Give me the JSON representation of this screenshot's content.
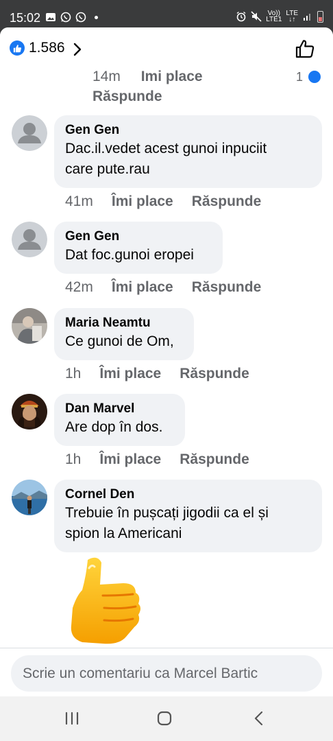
{
  "status_bar": {
    "time": "15:02",
    "volte_top": "Vo))",
    "volte_bottom": "LTE1",
    "network": "LTE"
  },
  "header": {
    "like_count": "1.586",
    "icons": [
      "like-badge-icon",
      "chevron-right-icon",
      "thumbs-up-outline-icon"
    ]
  },
  "partial_comment": {
    "time": "14m",
    "like_label": "Îmi place",
    "reply_label": "Răspunde",
    "reaction_count": "1"
  },
  "comments": [
    {
      "author": "Gen Gen",
      "text_lines": [
        "Dac.il.vedet acest gunoi inpuciit",
        "care pute.rau"
      ],
      "time": "41m",
      "like_label": "Îmi place",
      "reply_label": "Răspunde",
      "avatar": "default-avatar"
    },
    {
      "author": "Gen Gen",
      "text_lines": [
        "Dat foc.gunoi eropei"
      ],
      "time": "42m",
      "like_label": "Îmi place",
      "reply_label": "Răspunde",
      "avatar": "default-avatar"
    },
    {
      "author": "Maria Neamtu",
      "text_lines": [
        "Ce gunoi de Om,"
      ],
      "time": "1h",
      "like_label": "Îmi place",
      "reply_label": "Răspunde",
      "avatar": "photo-avatar"
    },
    {
      "author": "Dan Marvel",
      "text_lines": [
        "Are dop în dos."
      ],
      "time": "1h",
      "like_label": "Îmi place",
      "reply_label": "Răspunde",
      "avatar": "photo-avatar"
    },
    {
      "author": "Cornel Den",
      "text_lines": [
        "Trebuie în pușcați jigodii ca el și",
        "spion la Americani"
      ],
      "time": "",
      "like_label": "",
      "reply_label": "",
      "avatar": "photo-avatar",
      "attachment": "thumbs-up-sticker"
    }
  ],
  "composer": {
    "placeholder": "Scrie un comentariu ca Marcel Bartic"
  },
  "nav_bar": {
    "icons": [
      "recent-apps-icon",
      "home-icon",
      "back-icon"
    ]
  },
  "colors": {
    "accent": "#1877f2",
    "bubble": "#f0f2f5",
    "secondary_text": "#65676b",
    "sticker": "#ffb400"
  }
}
